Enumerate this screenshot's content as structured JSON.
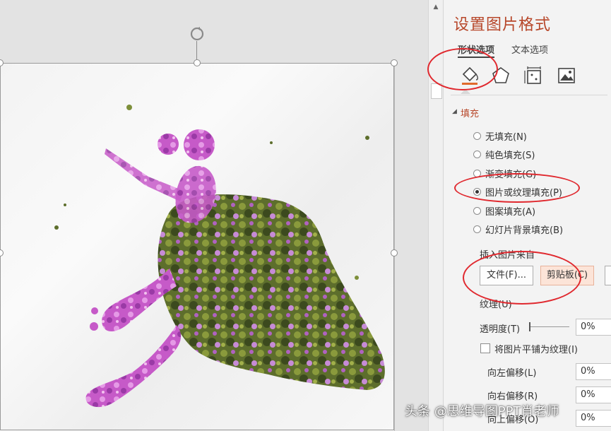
{
  "pane": {
    "title": "设置图片格式",
    "tabs": [
      {
        "label": "形状选项",
        "active": true
      },
      {
        "label": "文本选项",
        "active": false
      }
    ],
    "icons": [
      "fill-line-icon",
      "effects-icon",
      "size-properties-icon",
      "picture-icon"
    ],
    "section": {
      "label": "填充",
      "expanded": true
    },
    "fill_options": [
      {
        "label": "无填充(N)",
        "checked": false
      },
      {
        "label": "纯色填充(S)",
        "checked": false
      },
      {
        "label": "渐变填充(G)",
        "checked": false
      },
      {
        "label": "图片或纹理填充(P)",
        "checked": true
      },
      {
        "label": "图案填充(A)",
        "checked": false
      },
      {
        "label": "幻灯片背景填充(B)",
        "checked": false
      }
    ],
    "insert_from_label": "插入图片来自",
    "buttons": {
      "file": "文件(F)...",
      "clipboard": "剪贴板(C)"
    },
    "texture_label": "纹理(U)",
    "transparency": {
      "label": "透明度(T)",
      "value": "0%",
      "slider_fraction": 0
    },
    "tile_checkbox": {
      "label": "将图片平铺为纹理(I)",
      "checked": false
    },
    "offsets": [
      {
        "label": "向左偏移(L)",
        "value": "0%"
      },
      {
        "label": "向右偏移(R)",
        "value": "0%"
      },
      {
        "label": "向上偏移(O)",
        "value": "0%"
      }
    ]
  },
  "watermark": "头条 @思维导图PPT肖老师",
  "colors": {
    "accent": "#b7472a",
    "annotation": "#e0282e",
    "selected_button": "#fce4d8"
  }
}
